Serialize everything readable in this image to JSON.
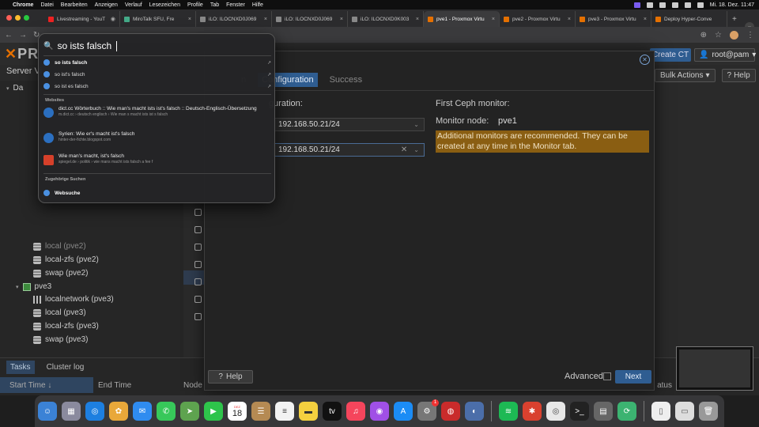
{
  "menubar": {
    "app": "Chrome",
    "items": [
      "Datei",
      "Bearbeiten",
      "Anzeigen",
      "Verlauf",
      "Lesezeichen",
      "Profile",
      "Tab",
      "Fenster",
      "Hilfe"
    ],
    "clock": "Mi. 18. Dez. 11:47"
  },
  "tabs": [
    {
      "title": "Livestreaming - YouT",
      "color": "#e22"
    },
    {
      "title": "MiroTalk SFU, Fre",
      "color": "#4a8"
    },
    {
      "title": "iLO: ILOCNXD0J069",
      "color": "#888"
    },
    {
      "title": "iLO: ILOCNXD0J069",
      "color": "#888"
    },
    {
      "title": "iLO: ILOCNXD0K003",
      "color": "#888"
    },
    {
      "title": "pve1 - Proxmox Virtu",
      "color": "#e57000"
    },
    {
      "title": "pve2 - Proxmox Virtu",
      "color": "#e57000"
    },
    {
      "title": "pve3 - Proxmox Virtu",
      "color": "#e57000"
    },
    {
      "title": "Deploy Hyper-Conve",
      "color": "#e57000"
    }
  ],
  "proxmox": {
    "logo_text": "PR",
    "left_title": "Server Vi",
    "datacenter": "Da",
    "user": "root@pam",
    "create_ct": "Create CT",
    "bulk_actions": "Bulk Actions",
    "help": "Help",
    "tree": [
      {
        "label": "local (pve2)",
        "icon": "db"
      },
      {
        "label": "local-zfs (pve2)",
        "icon": "db"
      },
      {
        "label": "swap (pve2)",
        "icon": "db"
      },
      {
        "label": "pve3",
        "icon": "node"
      },
      {
        "label": "localnetwork (pve3)",
        "icon": "grid"
      },
      {
        "label": "local (pve3)",
        "icon": "db"
      },
      {
        "label": "local-zfs (pve3)",
        "icon": "db"
      },
      {
        "label": "swap (pve3)",
        "icon": "db"
      }
    ],
    "bottom": {
      "tabs": [
        "Tasks",
        "Cluster log"
      ],
      "columns": {
        "start": "Start Time ↓",
        "end": "End Time",
        "node": "Node",
        "status": "atus"
      }
    }
  },
  "wizard": {
    "tabs": {
      "partial": "n",
      "configuration": "Configuration",
      "success": "Success"
    },
    "network_label": "guration:",
    "public_network": "192.168.50.21/24",
    "cluster_network": "192.168.50.21/24",
    "ceph_title": "First Ceph monitor:",
    "monitor_label": "Monitor node:",
    "monitor_value": "pve1",
    "warning": "Additional monitors are recommended. They can be created at any time in the Monitor tab.",
    "help": "Help",
    "advanced": "Advanced",
    "next": "Next"
  },
  "spotlight": {
    "query": "so ists falsch",
    "suggestions": [
      {
        "bold": "so ists falsch",
        "rest": ""
      },
      {
        "bold": "so ist",
        "rest": "'s falsch"
      },
      {
        "bold": "so ist",
        "rest": " es falsch"
      }
    ],
    "websites_header": "Websites",
    "websites": [
      {
        "title": "dict.cc Wörterbuch :: Wie man's macht ists ist's falsch :: Deutsch-Englisch-Übersetzung",
        "url": "m.dict.cc › deutsch englisch › Wie man s macht ists ist s falsch"
      },
      {
        "title": "Syrien: Wie er's macht ist's falsch",
        "url": "hinter-der-fichte.blogspot.com"
      },
      {
        "title": "Wie man's macht, ist's falsch",
        "url": "spiegel.de › politik › wie mans macht ists falsch a fee f"
      }
    ],
    "related_header": "Zugehörige Suchen",
    "websuche": "Websuche"
  },
  "dock": {
    "calendar_month": "DEZ",
    "calendar_day": "18",
    "settings_badge": "1"
  }
}
